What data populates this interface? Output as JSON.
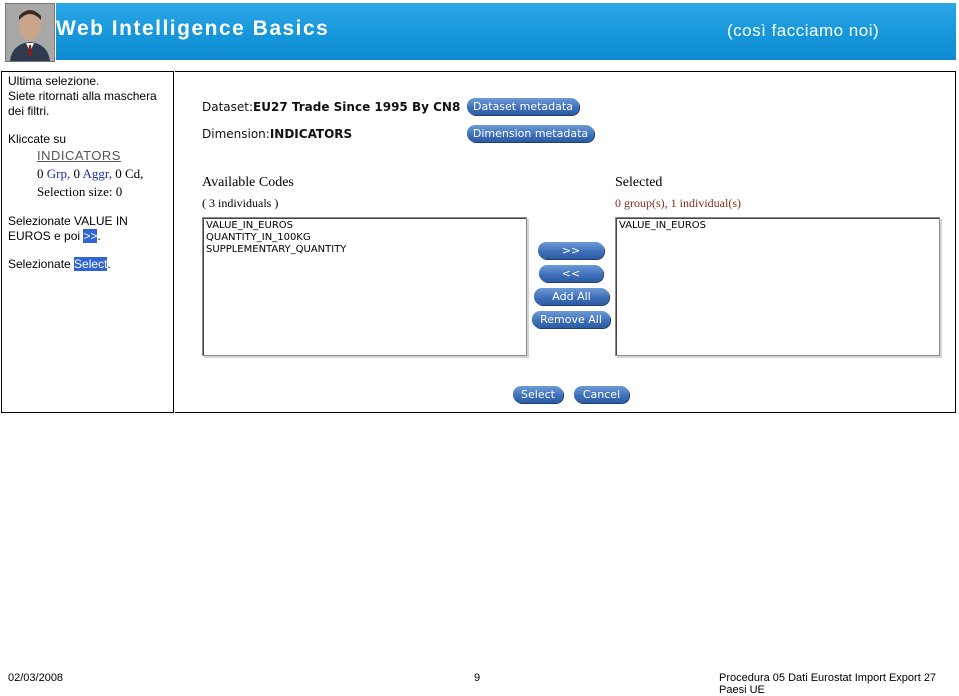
{
  "header": {
    "title": "Web Intelligence Basics",
    "subtitle": "(così facciamo noi)"
  },
  "instructions": {
    "line1": "Ultima selezione.",
    "line2": "Siete ritornati alla maschera",
    "line3": "dei filtri.",
    "line4": "Kliccate su",
    "indicators_link": "INDICATORS",
    "grp_count": "0",
    "grp_label": "Grp,",
    "aggr_count": "0",
    "aggr_label": "Aggr,",
    "cd_count": "0",
    "cd_label": "Cd,",
    "selection_size": "Selection size: 0",
    "step1_a": "Selezionate VALUE IN",
    "step1_b": "EUROS e poi ",
    "step1_btn": ">>",
    "step1_end": ".",
    "step2_a": "Selezionate ",
    "step2_btn": "Select",
    "step2_end": "."
  },
  "app": {
    "dataset_label": "Dataset:",
    "dataset_value": "EU27 Trade Since 1995 By CN8",
    "dimension_label": "Dimension:",
    "dimension_value": "INDICATORS",
    "dataset_metadata_btn": "Dataset metadata",
    "dimension_metadata_btn": "Dimension metadata",
    "available_title": "Available Codes",
    "available_count": "( 3 individuals )",
    "available_items": [
      "VALUE_IN_EUROS",
      "QUANTITY_IN_100KG",
      "SUPPLEMENTARY_QUANTITY"
    ],
    "selected_title": "Selected",
    "selected_count": "0 group(s), 1 individual(s)",
    "selected_items": [
      "VALUE_IN_EUROS"
    ],
    "add_btn": ">>",
    "remove_btn": "<<",
    "add_all_btn": "Add All",
    "remove_all_btn": "Remove All",
    "select_btn": "Select",
    "cancel_btn": "Cancel"
  },
  "footer": {
    "date": "02/03/2008",
    "page": "9",
    "doc_title": "Procedura 05 Dati Eurostat Import Export 27 Paesi UE"
  },
  "colors": {
    "banner": "#1696db",
    "button": "#3d6fb8",
    "accent_blue": "#1a2fa8"
  }
}
